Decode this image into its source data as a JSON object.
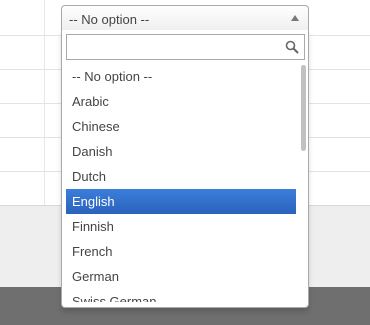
{
  "select": {
    "current_value": "-- No option --"
  },
  "search": {
    "value": "",
    "placeholder": ""
  },
  "options": [
    {
      "label": "-- No option --"
    },
    {
      "label": "Arabic"
    },
    {
      "label": "Chinese"
    },
    {
      "label": "Danish"
    },
    {
      "label": "Dutch"
    },
    {
      "label": "English",
      "highlighted": true
    },
    {
      "label": "Finnish"
    },
    {
      "label": "French"
    },
    {
      "label": "German"
    },
    {
      "label": "Swiss German"
    }
  ],
  "colors": {
    "highlight": "#3875d7",
    "highlight_text": "#ffffff",
    "border": "#aaaaaa"
  },
  "icons": {
    "search": "magnifier-icon",
    "caret": "caret-up-icon"
  }
}
